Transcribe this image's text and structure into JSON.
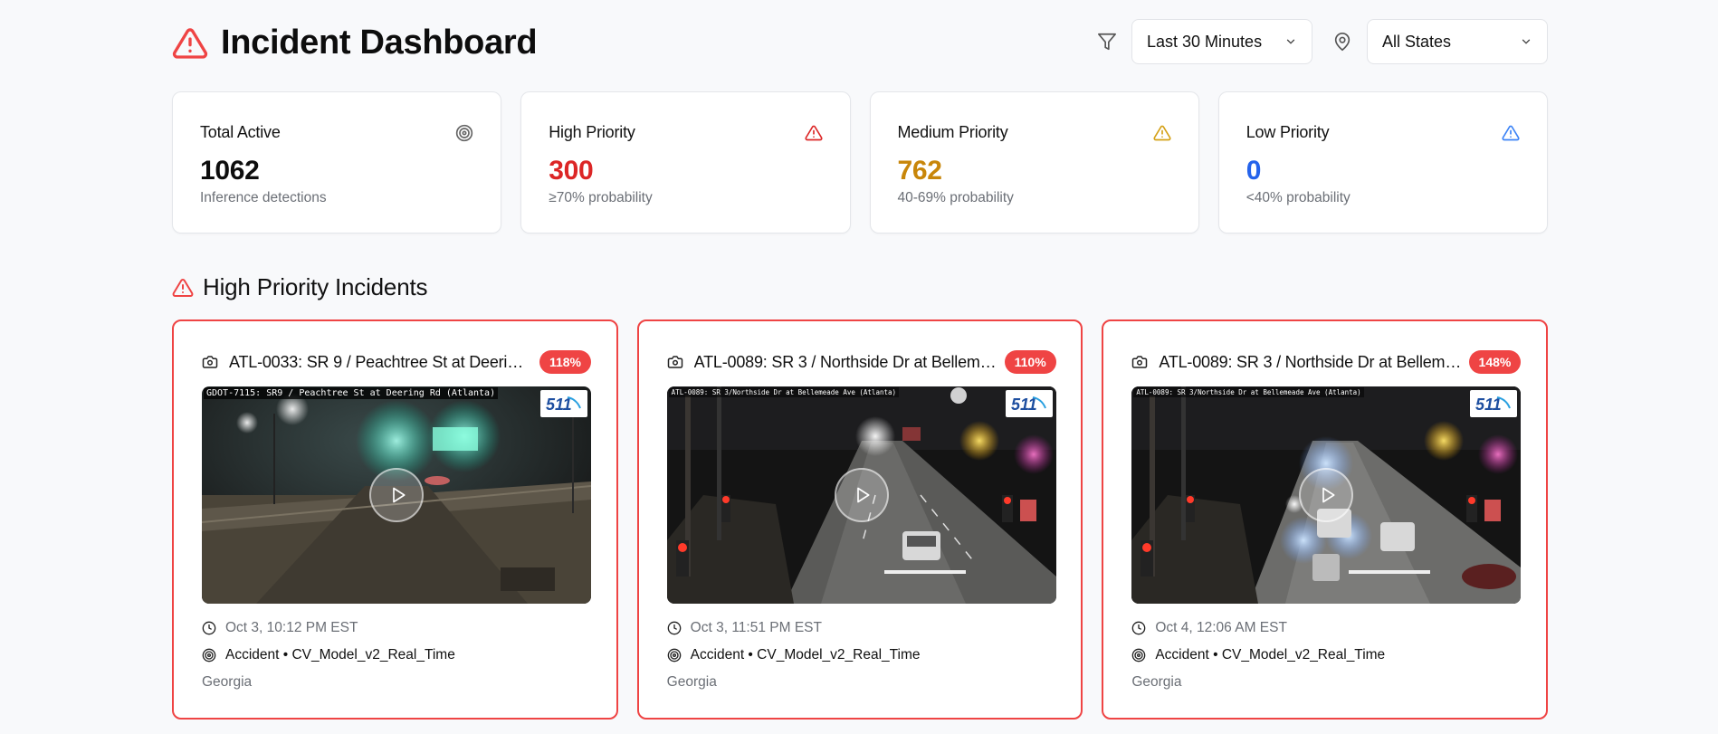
{
  "header": {
    "title": "Incident Dashboard",
    "time_filter": "Last 30 Minutes",
    "state_filter": "All States"
  },
  "stats": [
    {
      "label": "Total Active",
      "value": "1062",
      "sub": "Inference detections",
      "icon": "target-icon",
      "color": "#0d0d0d"
    },
    {
      "label": "High Priority",
      "value": "300",
      "sub": "≥70% probability",
      "icon": "alert-triangle-icon",
      "color": "#dc2626"
    },
    {
      "label": "Medium Priority",
      "value": "762",
      "sub": "40-69% probability",
      "icon": "alert-triangle-icon",
      "color": "#c8860a"
    },
    {
      "label": "Low Priority",
      "value": "0",
      "sub": "<40% probability",
      "icon": "alert-triangle-icon",
      "color": "#2563eb"
    }
  ],
  "section": {
    "title": "High Priority Incidents"
  },
  "incidents": [
    {
      "title": "ATL-0033: SR 9 / Peachtree St at Deering R...",
      "badge": "118%",
      "camera_banner": "GDOT-7115: SR9 / Peachtree St at Deering Rd (Atlanta)",
      "time": "Oct 3, 10:12 PM EST",
      "type": "Accident • CV_Model_v2_Real_Time",
      "state": "Georgia"
    },
    {
      "title": "ATL-0089: SR 3 / Northside Dr at Bellemea...",
      "badge": "110%",
      "camera_banner": "ATL-0089: SR 3/Northside Dr at Bellemeade Ave (Atlanta)",
      "time": "Oct 3, 11:51 PM EST",
      "type": "Accident • CV_Model_v2_Real_Time",
      "state": "Georgia"
    },
    {
      "title": "ATL-0089: SR 3 / Northside Dr at Bellemea...",
      "badge": "148%",
      "camera_banner": "ATL-0089: SR 3/Northside Dr at Bellemeade Ave (Atlanta)",
      "time": "Oct 4, 12:06 AM EST",
      "type": "Accident • CV_Model_v2_Real_Time",
      "state": "Georgia"
    }
  ],
  "logo_text": "511",
  "colors": {
    "accent_red": "#ef4444",
    "high": "#dc2626",
    "medium": "#c8860a",
    "low": "#2563eb"
  }
}
